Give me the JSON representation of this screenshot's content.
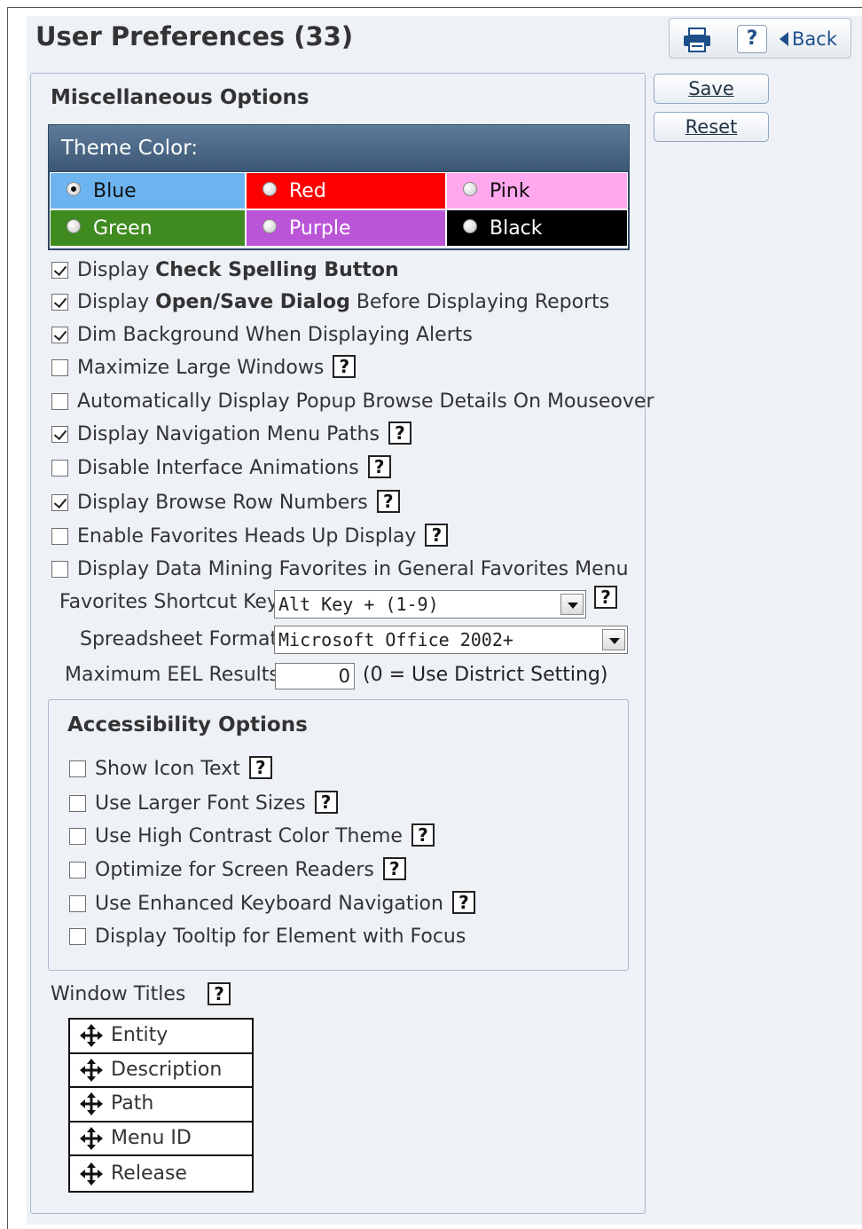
{
  "header": {
    "title": "User Preferences (33)",
    "help_label": "?",
    "back_label": "Back"
  },
  "actions": {
    "save_label": "Save",
    "reset_label": "Reset"
  },
  "misc": {
    "title": "Miscellaneous Options",
    "theme_header": "Theme Color:",
    "themes": [
      {
        "label": "Blue",
        "color": "#6cb4f0",
        "text_color": "#111111",
        "selected": true
      },
      {
        "label": "Red",
        "color": "#ff0000",
        "text_color": "#ffffff",
        "selected": false
      },
      {
        "label": "Pink",
        "color": "#ffa8ee",
        "text_color": "#111111",
        "selected": false
      },
      {
        "label": "Green",
        "color": "#3f8b20",
        "text_color": "#ffffff",
        "selected": false
      },
      {
        "label": "Purple",
        "color": "#bb55d8",
        "text_color": "#ffffff",
        "selected": false
      },
      {
        "label": "Black",
        "color": "#000000",
        "text_color": "#ffffff",
        "selected": false
      }
    ],
    "options": [
      {
        "pre": "Display ",
        "bold": "Check Spelling Button",
        "post": "",
        "checked": true,
        "help": false
      },
      {
        "pre": "Display ",
        "bold": "Open/Save Dialog",
        "post": " Before Displaying Reports",
        "checked": true,
        "help": false
      },
      {
        "pre": "Dim Background When Displaying Alerts",
        "bold": "",
        "post": "",
        "checked": true,
        "help": false
      },
      {
        "pre": "Maximize Large Windows",
        "bold": "",
        "post": "",
        "checked": false,
        "help": true
      },
      {
        "pre": "Automatically Display Popup Browse Details On Mouseover",
        "bold": "",
        "post": "",
        "checked": false,
        "help": false
      },
      {
        "pre": "Display Navigation Menu Paths",
        "bold": "",
        "post": "",
        "checked": true,
        "help": true
      },
      {
        "pre": "Disable Interface Animations",
        "bold": "",
        "post": "",
        "checked": false,
        "help": true
      },
      {
        "pre": "Display Browse Row Numbers",
        "bold": "",
        "post": "",
        "checked": true,
        "help": true
      },
      {
        "pre": "Enable Favorites Heads Up Display",
        "bold": "",
        "post": "",
        "checked": false,
        "help": true
      },
      {
        "pre": "Display Data Mining Favorites in General Favorites Menu",
        "bold": "",
        "post": "",
        "checked": false,
        "help": false
      }
    ],
    "favorites_shortcut_label": "Favorites Shortcut Key:",
    "favorites_shortcut_value": "Alt Key + (1-9)",
    "spreadsheet_label": "Spreadsheet Format:",
    "spreadsheet_value": "Microsoft Office 2002+",
    "eel_label": "Maximum EEL Results:",
    "eel_value": "0",
    "eel_note": "(0 = Use District Setting)"
  },
  "accessibility": {
    "title": "Accessibility Options",
    "options": [
      {
        "label": "Show Icon Text",
        "checked": false,
        "help": true
      },
      {
        "label": "Use Larger Font Sizes",
        "checked": false,
        "help": true
      },
      {
        "label": "Use High Contrast Color Theme",
        "checked": false,
        "help": true
      },
      {
        "label": "Optimize for Screen Readers",
        "checked": false,
        "help": true
      },
      {
        "label": "Use Enhanced Keyboard Navigation",
        "checked": false,
        "help": true
      },
      {
        "label": "Display Tooltip for Element with Focus",
        "checked": false,
        "help": false
      }
    ]
  },
  "window_titles": {
    "label": "Window Titles",
    "items": [
      "Entity",
      "Description",
      "Path",
      "Menu ID",
      "Release"
    ]
  }
}
